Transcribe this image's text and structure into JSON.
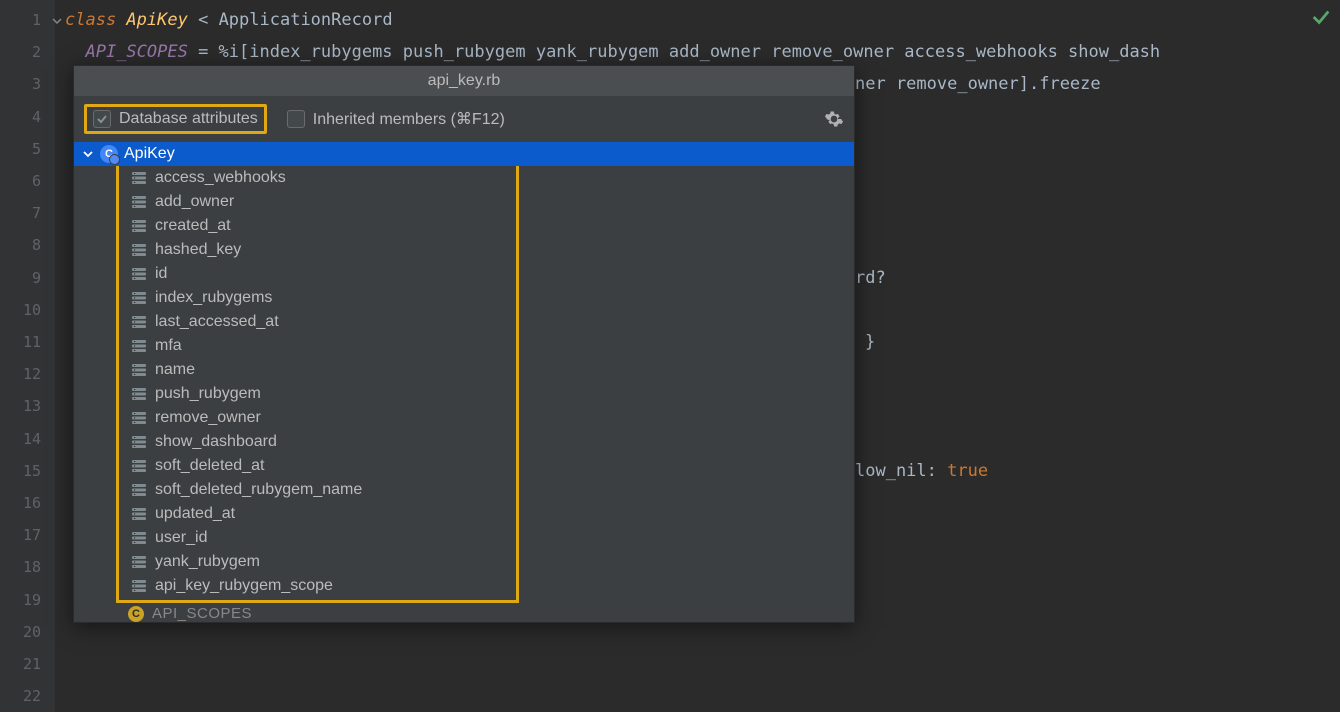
{
  "gutter": [
    "1",
    "2",
    "3",
    "4",
    "5",
    "6",
    "7",
    "8",
    "9",
    "10",
    "11",
    "12",
    "13",
    "14",
    "15",
    "16",
    "17",
    "18",
    "19",
    "20",
    "21",
    "22"
  ],
  "code": {
    "l1_kw": "class ",
    "l1_cls": "ApiKey",
    "l1_op": " < ",
    "l1_super": "ApplicationRecord",
    "l2_const": "API_SCOPES",
    "l2_rest": " = %i[index_rubygems push_rubygem yank_rubygem add_owner remove_owner access_webhooks show_dash",
    "l3_vis": "ner remove_owner].freeze",
    "l9_vis": "rd?",
    "l11_vis": "}",
    "l15_vis": "low_nil: ",
    "l15_true": "true"
  },
  "popup": {
    "title": "api_key.rb",
    "db_label": "Database attributes",
    "inh_label": "Inherited members (⌘F12)",
    "root": "ApiKey",
    "root_badge": "C",
    "attrs": [
      "access_webhooks",
      "add_owner",
      "created_at",
      "hashed_key",
      "id",
      "index_rubygems",
      "last_accessed_at",
      "mfa",
      "name",
      "push_rubygem",
      "remove_owner",
      "show_dashboard",
      "soft_deleted_at",
      "soft_deleted_rubygem_name",
      "updated_at",
      "user_id",
      "yank_rubygem",
      "api_key_rubygem_scope"
    ],
    "more": "API_SCOPES"
  }
}
